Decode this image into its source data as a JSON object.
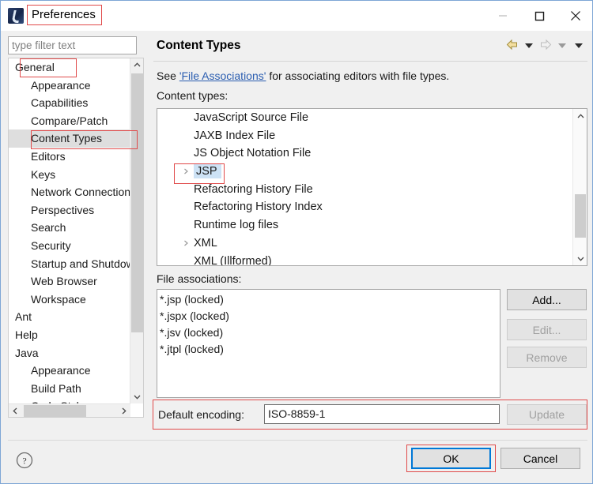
{
  "window": {
    "title": "Preferences",
    "icon": "eclipse-icon",
    "minimize_label": "–",
    "maximize_label": "□",
    "close_label": "✕"
  },
  "sidebar": {
    "filter": {
      "placeholder": "type filter text",
      "value": ""
    },
    "items": [
      {
        "label": "General",
        "level": 1,
        "selected": false
      },
      {
        "label": "Appearance",
        "level": 2,
        "selected": false
      },
      {
        "label": "Capabilities",
        "level": 2,
        "selected": false
      },
      {
        "label": "Compare/Patch",
        "level": 2,
        "selected": false
      },
      {
        "label": "Content Types",
        "level": 2,
        "selected": true
      },
      {
        "label": "Editors",
        "level": 2,
        "selected": false
      },
      {
        "label": "Keys",
        "level": 2,
        "selected": false
      },
      {
        "label": "Network Connections",
        "level": 2,
        "selected": false
      },
      {
        "label": "Perspectives",
        "level": 2,
        "selected": false
      },
      {
        "label": "Search",
        "level": 2,
        "selected": false
      },
      {
        "label": "Security",
        "level": 2,
        "selected": false
      },
      {
        "label": "Startup and Shutdown",
        "level": 2,
        "selected": false
      },
      {
        "label": "Web Browser",
        "level": 2,
        "selected": false
      },
      {
        "label": "Workspace",
        "level": 2,
        "selected": false
      },
      {
        "label": "Ant",
        "level": 1,
        "selected": false
      },
      {
        "label": "Help",
        "level": 1,
        "selected": false
      },
      {
        "label": "Java",
        "level": 1,
        "selected": false
      },
      {
        "label": "Appearance",
        "level": 2,
        "selected": false
      },
      {
        "label": "Build Path",
        "level": 2,
        "selected": false
      },
      {
        "label": "Code Style",
        "level": 2,
        "selected": false
      }
    ]
  },
  "pane": {
    "title": "Content Types",
    "see_prefix": "See ",
    "see_link": "'File Associations'",
    "see_suffix": " for associating editors with file types.",
    "content_types_label": "Content types:",
    "nav": {
      "back": "back-arrow",
      "back_menu": "back-dropdown",
      "forward": "forward-arrow",
      "forward_menu": "forward-dropdown",
      "view_menu": "view-menu-dropdown"
    },
    "content_types": [
      {
        "label": "JavaScript Source File",
        "expandable": false,
        "selected": false
      },
      {
        "label": "JAXB Index File",
        "expandable": false,
        "selected": false
      },
      {
        "label": "JS Object Notation File",
        "expandable": false,
        "selected": false
      },
      {
        "label": "JSP",
        "expandable": true,
        "selected": true
      },
      {
        "label": "Refactoring History File",
        "expandable": false,
        "selected": false
      },
      {
        "label": "Refactoring History Index",
        "expandable": false,
        "selected": false
      },
      {
        "label": "Runtime log files",
        "expandable": false,
        "selected": false
      },
      {
        "label": "XML",
        "expandable": true,
        "selected": false
      },
      {
        "label": "XML (Illformed)",
        "expandable": false,
        "selected": false
      }
    ],
    "file_associations_label": "File associations:",
    "file_associations": [
      "*.jsp (locked)",
      "*.jspx (locked)",
      "*.jsv (locked)",
      "*.jtpl (locked)"
    ],
    "buttons": {
      "add": "Add...",
      "edit": "Edit...",
      "remove": "Remove",
      "update": "Update"
    },
    "encoding_label": "Default encoding:",
    "encoding_value": "ISO-8859-1"
  },
  "footer": {
    "help": "?",
    "ok": "OK",
    "cancel": "Cancel"
  },
  "colors": {
    "annotation": "#e04a4a",
    "selection": "#cde2f5",
    "tree_selection": "#dedede",
    "link": "#2a5db0",
    "focus": "#0078d7"
  }
}
